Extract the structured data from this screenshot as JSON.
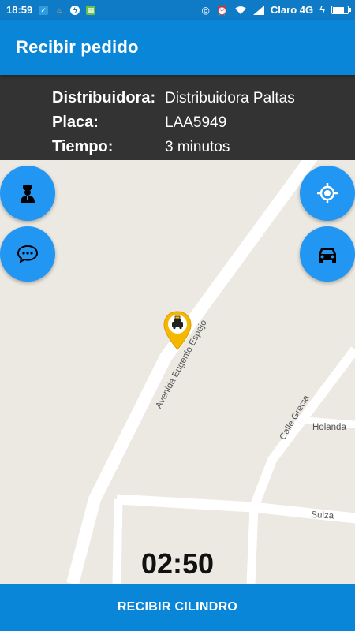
{
  "status_bar": {
    "time": "18:59",
    "carrier": "Claro 4G",
    "battery_level": 0.85,
    "notification_icons": [
      "shield-icon",
      "fire-icon",
      "messenger-icon",
      "app-icon"
    ],
    "system_icons": [
      "nfc-icon",
      "alarm-icon",
      "wifi-icon",
      "signal-icon",
      "charging-icon"
    ]
  },
  "app_bar": {
    "title": "Recibir pedido"
  },
  "info": {
    "distribuidora_label": "Distribuidora:",
    "distribuidora_value": "Distribuidora Paltas",
    "placa_label": "Placa:",
    "placa_value": "LAA5949",
    "tiempo_label": "Tiempo:",
    "tiempo_value": "3 minutos"
  },
  "map": {
    "streets": {
      "avenida": "Avenida Eugenio Espejo",
      "grecia": "Calle Grecia",
      "holanda": "Holanda",
      "suiza": "Suiza"
    },
    "marker_icon": "taxi-marker-icon"
  },
  "fabs": {
    "left_top": "driver-icon",
    "left_bottom": "chat-icon",
    "right_top": "my-location-icon",
    "right_bottom": "car-icon"
  },
  "timer": "02:50",
  "bottom_button": {
    "label": "RECIBIR CILINDRO"
  },
  "colors": {
    "primary": "#0a86d8",
    "status_bar": "#0f7bc6",
    "fab": "#2196f3",
    "info_panel": "#333333",
    "map_bg": "#ebe9e1",
    "marker": "#f5b800"
  }
}
